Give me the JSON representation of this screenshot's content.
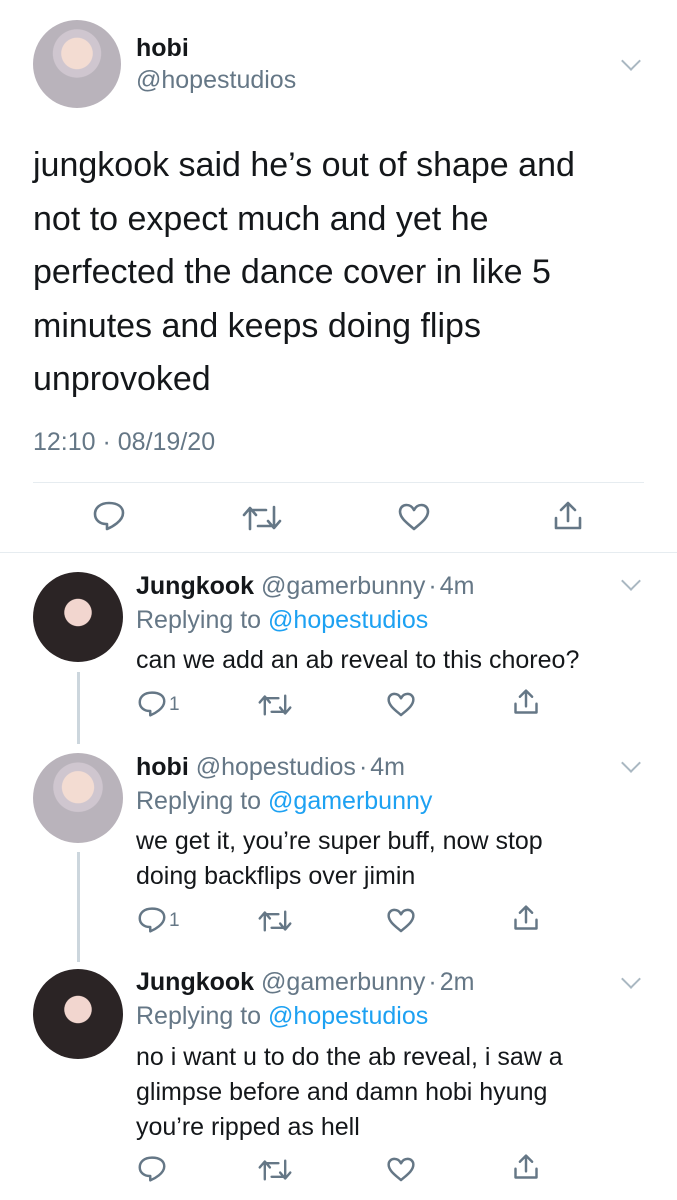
{
  "main_tweet": {
    "display_name": "hobi",
    "handle": "@hopestudios",
    "text_lines": [
      "jungkook said he’s out of shape and",
      "not to expect much and yet he",
      "perfected the dance cover in like 5",
      "minutes and keeps doing flips",
      "unprovoked"
    ],
    "timestamp": "12:10 · 08/19/20",
    "avatar_icon": "avatar-hobi"
  },
  "replies": [
    {
      "display_name": "Jungkook",
      "handle": "@gamerbunny",
      "sep": "·",
      "time": "4m",
      "replying_prefix": "Replying to",
      "replying_to": "@hopestudios",
      "text_lines": [
        "can we add an ab reveal to this choreo?"
      ],
      "reply_count": "1",
      "avatar_icon": "avatar-jungkook"
    },
    {
      "display_name": "hobi",
      "handle": "@hopestudios",
      "sep": "·",
      "time": "4m",
      "replying_prefix": "Replying to",
      "replying_to": "@gamerbunny",
      "text_lines": [
        "we get it, you’re super buff, now stop",
        "doing backflips over jimin"
      ],
      "reply_count": "1",
      "avatar_icon": "avatar-hobi"
    },
    {
      "display_name": "Jungkook",
      "handle": "@gamerbunny",
      "sep": "·",
      "time": "2m",
      "replying_prefix": "Replying to",
      "replying_to": "@hopestudios",
      "text_lines": [
        "no i want u to do the ab reveal, i saw a",
        "glimpse before and damn hobi hyung",
        "you’re ripped as hell"
      ],
      "reply_count": "",
      "avatar_icon": "avatar-jungkook"
    }
  ],
  "colors": {
    "text": "#14171a",
    "muted": "#657786",
    "link": "#1da1f2",
    "divider": "#e6ecf0",
    "thread_line": "#ccd6dd"
  },
  "icons": {
    "reply": "reply-icon",
    "retweet": "retweet-icon",
    "like": "heart-icon",
    "share": "share-icon",
    "more": "chevron-down-icon"
  }
}
